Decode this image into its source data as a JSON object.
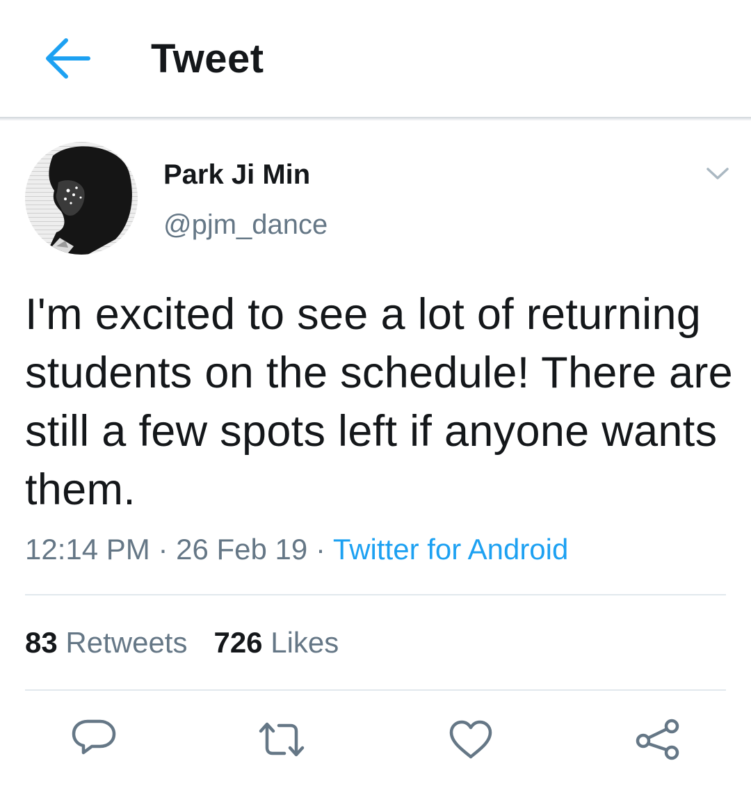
{
  "header": {
    "title": "Tweet",
    "back_icon": "arrow-left-icon",
    "accent_color": "#1da1f2"
  },
  "author": {
    "display_name": "Park Ji Min",
    "handle": "@pjm_dance",
    "menu_icon": "chevron-down-icon"
  },
  "tweet": {
    "text": "I'm excited to see a lot of returning students on the schedule! There are still a few spots left if anyone wants them.",
    "time": "12:14 PM",
    "date": "26 Feb 19",
    "separator": "·",
    "source": "Twitter for Android"
  },
  "stats": {
    "retweets_count": "83",
    "retweets_label": "Retweets",
    "likes_count": "726",
    "likes_label": "Likes"
  },
  "actions": {
    "reply_icon": "reply-icon",
    "retweet_icon": "retweet-icon",
    "like_icon": "heart-icon",
    "share_icon": "share-icon"
  },
  "colors": {
    "text": "#14171a",
    "secondary": "#657786",
    "link": "#1da1f2",
    "divider": "#e1e8ed"
  }
}
